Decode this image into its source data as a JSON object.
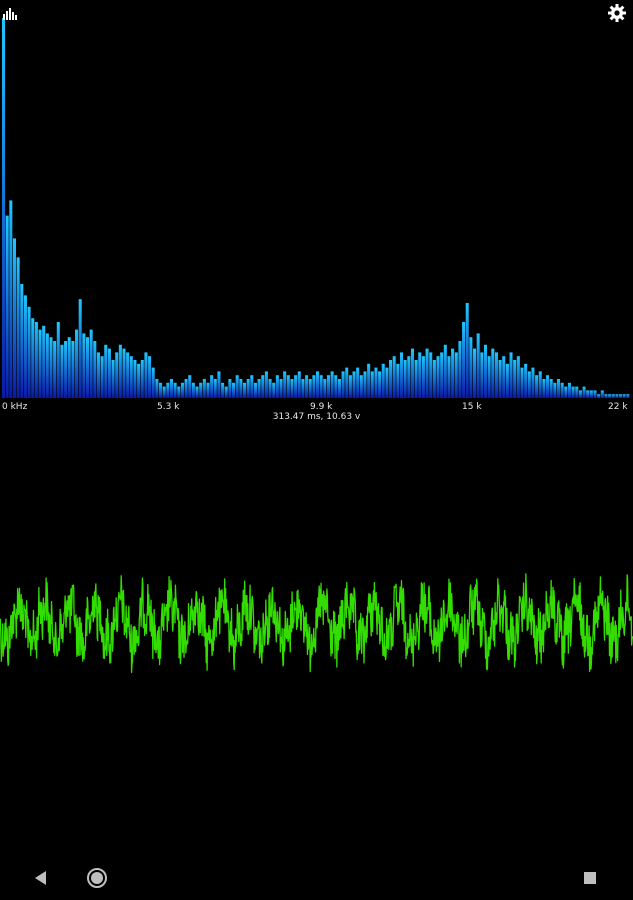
{
  "icons": {
    "top_left": "bar-chart-icon",
    "top_right": "gear-icon",
    "nav_back": "back-triangle-icon",
    "nav_home": "home-circle-icon",
    "nav_recents": "recents-square-icon"
  },
  "colors": {
    "spectrum_top": "#1fc8ff",
    "spectrum_bottom": "#0a1aa8",
    "waveform": "#33dd00",
    "background": "#000000"
  },
  "spectrum": {
    "x_axis_labels": [
      "0 kHz",
      "5.3 k",
      "9.9 k",
      "15 k",
      "22 k"
    ],
    "status": "313.47 ms, 10.63 v"
  },
  "chart_data": {
    "type": "bar",
    "xlabel": "",
    "ylabel": "",
    "xlim_khz": [
      0,
      22
    ],
    "x_ticks": [
      "0 kHz",
      "5.3 k",
      "9.9 k",
      "15 k",
      "22 k"
    ],
    "peaks": [
      {
        "khz": 0.05,
        "level": 1.0
      },
      {
        "khz": 0.35,
        "level": 0.52
      },
      {
        "khz": 0.7,
        "level": 0.37
      },
      {
        "khz": 2.2,
        "level": 0.26
      },
      {
        "khz": 13.9,
        "level": 0.25
      }
    ],
    "bin_levels": [
      1.0,
      0.48,
      0.52,
      0.42,
      0.37,
      0.3,
      0.27,
      0.24,
      0.21,
      0.2,
      0.18,
      0.19,
      0.17,
      0.16,
      0.15,
      0.2,
      0.14,
      0.15,
      0.16,
      0.15,
      0.18,
      0.26,
      0.17,
      0.16,
      0.18,
      0.15,
      0.12,
      0.11,
      0.14,
      0.13,
      0.1,
      0.12,
      0.14,
      0.13,
      0.12,
      0.11,
      0.1,
      0.09,
      0.1,
      0.12,
      0.11,
      0.08,
      0.05,
      0.04,
      0.03,
      0.04,
      0.05,
      0.04,
      0.03,
      0.04,
      0.05,
      0.06,
      0.04,
      0.03,
      0.04,
      0.05,
      0.04,
      0.06,
      0.05,
      0.07,
      0.04,
      0.03,
      0.05,
      0.04,
      0.06,
      0.05,
      0.04,
      0.05,
      0.06,
      0.04,
      0.05,
      0.06,
      0.07,
      0.05,
      0.04,
      0.06,
      0.05,
      0.07,
      0.06,
      0.05,
      0.06,
      0.07,
      0.05,
      0.06,
      0.05,
      0.06,
      0.07,
      0.06,
      0.05,
      0.06,
      0.07,
      0.06,
      0.05,
      0.07,
      0.08,
      0.06,
      0.07,
      0.08,
      0.06,
      0.07,
      0.09,
      0.07,
      0.08,
      0.07,
      0.09,
      0.08,
      0.1,
      0.11,
      0.09,
      0.12,
      0.1,
      0.11,
      0.13,
      0.1,
      0.12,
      0.11,
      0.13,
      0.12,
      0.1,
      0.11,
      0.12,
      0.14,
      0.11,
      0.13,
      0.12,
      0.15,
      0.2,
      0.25,
      0.16,
      0.13,
      0.17,
      0.12,
      0.14,
      0.11,
      0.13,
      0.12,
      0.1,
      0.11,
      0.09,
      0.12,
      0.1,
      0.11,
      0.08,
      0.09,
      0.07,
      0.08,
      0.06,
      0.07,
      0.05,
      0.06,
      0.05,
      0.04,
      0.05,
      0.04,
      0.03,
      0.04,
      0.03,
      0.03,
      0.02,
      0.03,
      0.02,
      0.02,
      0.02,
      0.01,
      0.02,
      0.01,
      0.01,
      0.01,
      0.01,
      0.01,
      0.01,
      0.01
    ]
  },
  "waveform": {
    "cycles": 25
  }
}
